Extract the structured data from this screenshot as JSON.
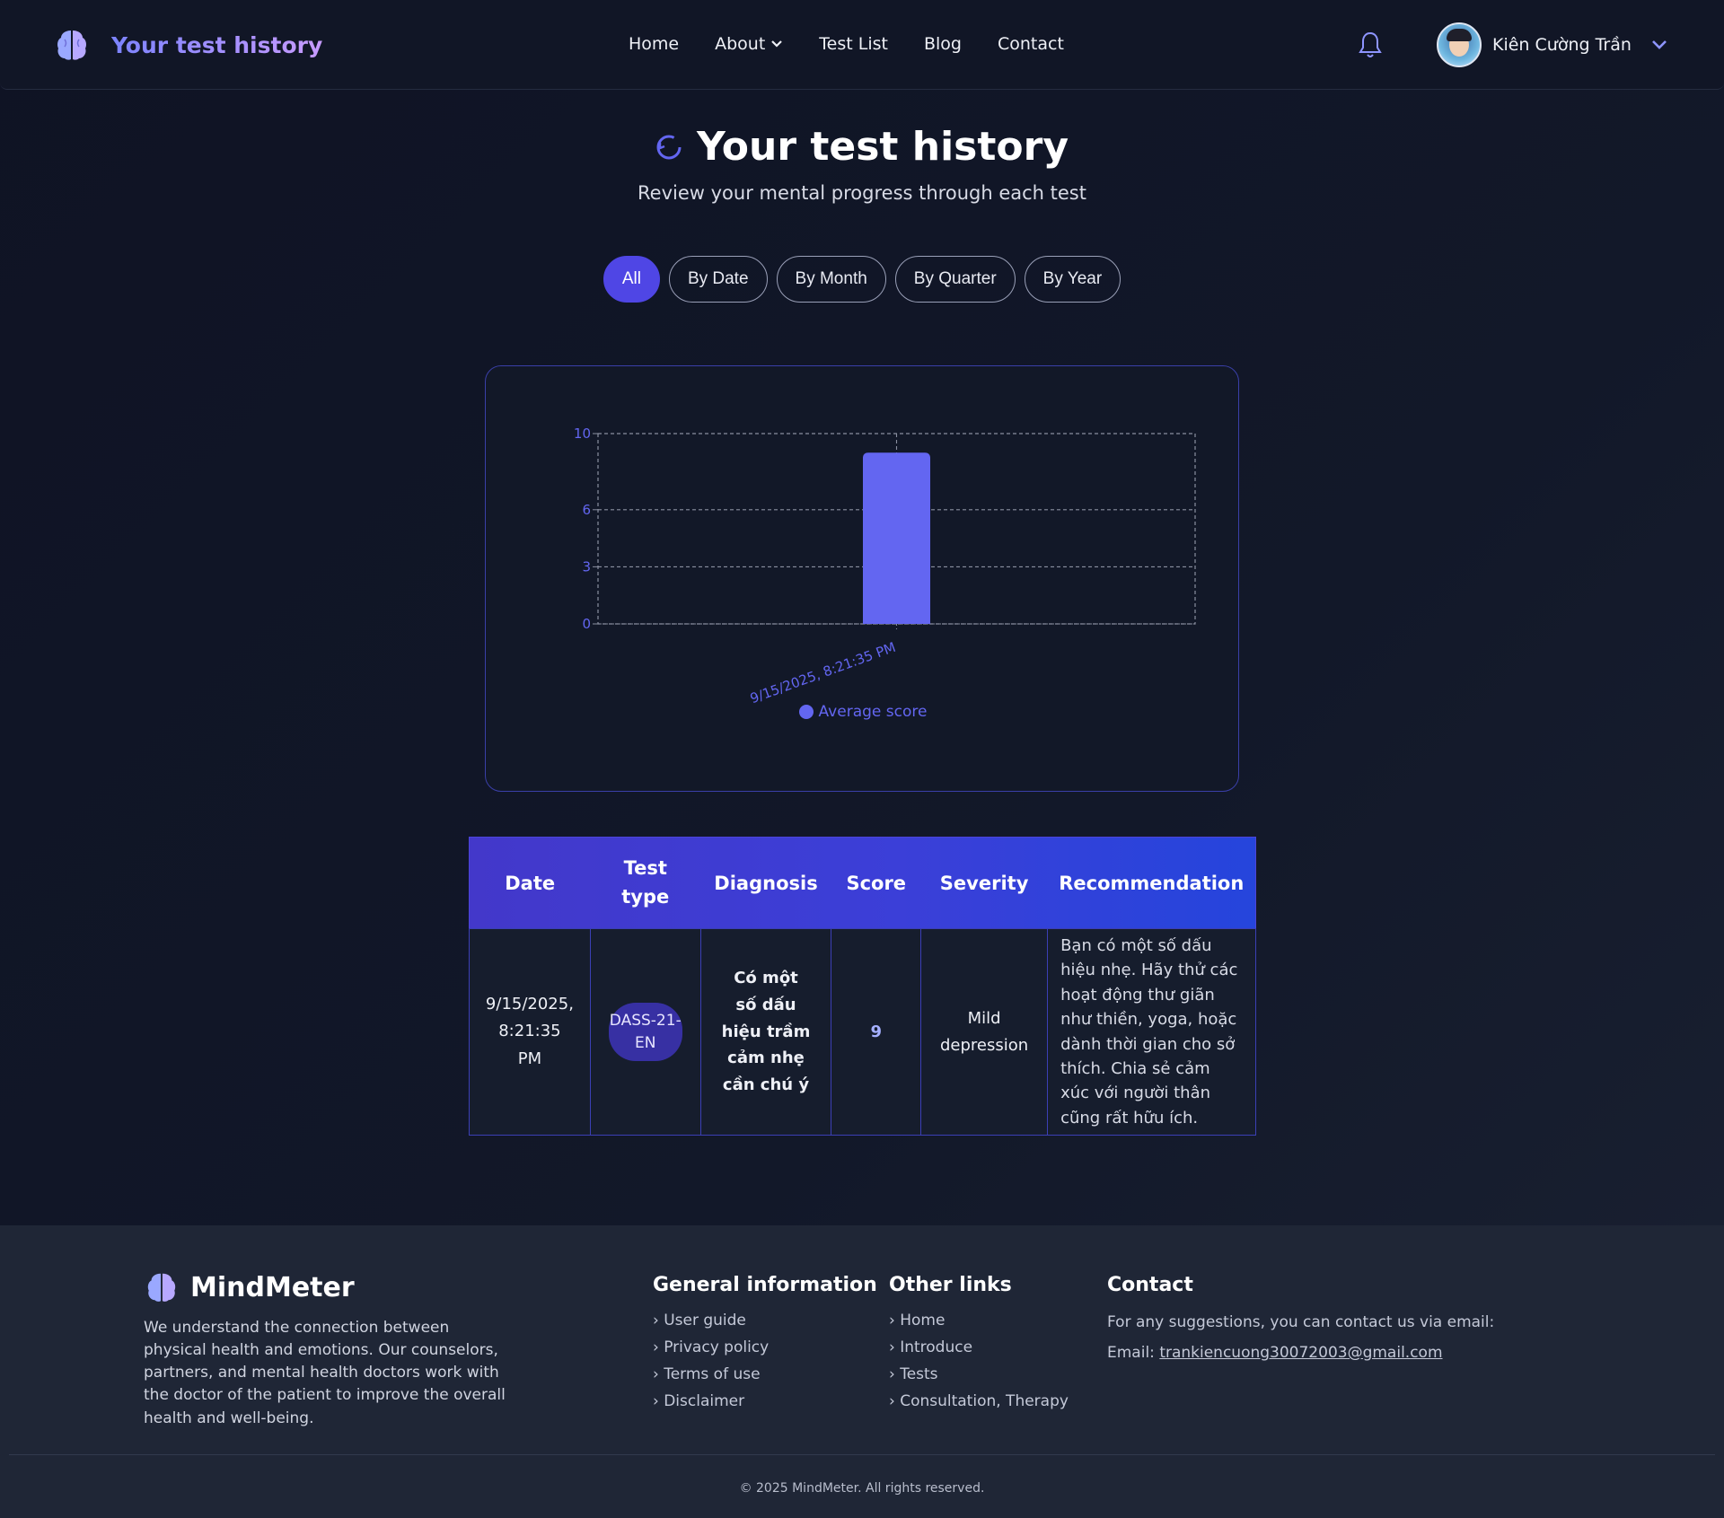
{
  "navbar": {
    "brand": "Your test history",
    "links": [
      "Home",
      "About",
      "Test List",
      "Blog",
      "Contact"
    ],
    "user_name": "Kiên Cường Trần"
  },
  "header": {
    "title": "Your test history",
    "subtitle": "Review your mental progress through each test"
  },
  "filters": [
    "All",
    "By Date",
    "By Month",
    "By Quarter",
    "By Year"
  ],
  "filters_active": "All",
  "chart_data": {
    "type": "bar",
    "categories": [
      "9/15/2025, 8:21:35 PM"
    ],
    "series": [
      {
        "name": "Average score",
        "values": [
          9
        ]
      }
    ],
    "yticks": [
      0,
      3,
      6,
      10
    ],
    "ylim": [
      0,
      10
    ],
    "grid": true,
    "legend": "bottom",
    "color": "#6366f1"
  },
  "table": {
    "headers": [
      "Date",
      "Test type",
      "Diagnosis",
      "Score",
      "Severity",
      "Recommendation"
    ],
    "rows": [
      {
        "date": "9/15/2025, 8:21:35 PM",
        "test_type": "DASS-21-EN",
        "diagnosis": "Có một số dấu hiệu trầm cảm nhẹ cần chú ý",
        "score": "9",
        "severity": "Mild depression",
        "recommendation": "Bạn có một số dấu hiệu nhẹ. Hãy thử các hoạt động thư giãn như thiền, yoga, hoặc dành thời gian cho sở thích. Chia sẻ cảm xúc với người thân cũng rất hữu ích."
      }
    ]
  },
  "footer": {
    "brand": "MindMeter",
    "description": "We understand the connection between physical health and emotions. Our counselors, partners, and mental health doctors work with the doctor of the patient to improve the overall health and well-being.",
    "general": {
      "title": "General information",
      "items": [
        "User guide",
        "Privacy policy",
        "Terms of use",
        "Disclaimer"
      ]
    },
    "other": {
      "title": "Other links",
      "items": [
        "Home",
        "Introduce",
        "Tests",
        "Consultation, Therapy"
      ]
    },
    "contact": {
      "title": "Contact",
      "text": "For any suggestions, you can contact us via email:",
      "email_label": "Email:",
      "email": "trankiencuong30072003@gmail.com"
    },
    "copyright": "© 2025 MindMeter. All rights reserved."
  },
  "colors": {
    "accent": "#4f46e5",
    "bar": "#6366f1",
    "background": "#0f1324"
  },
  "icons": [
    "brain-icon",
    "bell-icon",
    "chevron-down-icon",
    "history-icon"
  ]
}
